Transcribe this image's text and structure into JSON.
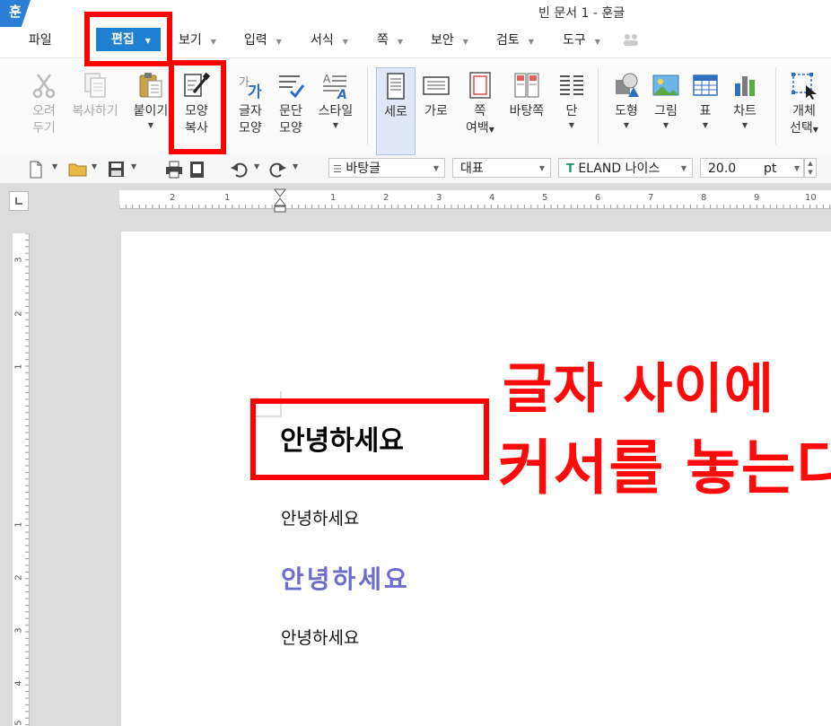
{
  "app": {
    "icon_text": "훈",
    "title": "빈 문서 1 - 훈글"
  },
  "menu": {
    "file": "파일",
    "items": [
      {
        "label": "편집",
        "active": true
      },
      {
        "label": "보기"
      },
      {
        "label": "입력"
      },
      {
        "label": "서식"
      },
      {
        "label": "쪽"
      },
      {
        "label": "보안"
      },
      {
        "label": "검토"
      },
      {
        "label": "도구"
      }
    ]
  },
  "ribbon": {
    "cut": {
      "line1": "오려",
      "line2": "두기"
    },
    "copy": {
      "label": "복사하기"
    },
    "paste": {
      "label": "붙이기"
    },
    "format_painter": {
      "line1": "모양",
      "line2": "복사"
    },
    "char_shape": {
      "line1": "글자",
      "line2": "모양"
    },
    "para_shape": {
      "line1": "문단",
      "line2": "모양"
    },
    "style": {
      "label": "스타일"
    },
    "portrait": {
      "label": "세로"
    },
    "landscape": {
      "label": "가로"
    },
    "page_margin": {
      "line1": "쪽",
      "line2": "여백"
    },
    "master_page": {
      "label": "바탕쪽"
    },
    "columns": {
      "label": "단"
    },
    "shape": {
      "label": "도형"
    },
    "picture": {
      "label": "그림"
    },
    "table": {
      "label": "표"
    },
    "chart": {
      "label": "차트"
    },
    "object_select": {
      "line1": "개체",
      "line2": "선택"
    }
  },
  "toolbar": {
    "style_select": "바탕글",
    "lang_select": "대표",
    "font_select": "ELAND 나이스",
    "font_size": "20.0",
    "font_unit": "pt"
  },
  "rulers": {
    "horizontal": [
      "2",
      "1",
      "1",
      "2",
      "3",
      "4",
      "5",
      "6",
      "7",
      "8",
      "9",
      "10"
    ],
    "vertical": [
      "3",
      "2",
      "1",
      "1",
      "2",
      "3",
      "4",
      "5"
    ]
  },
  "document": {
    "lines": [
      "안녕하세요",
      "안녕하세요",
      "안녕하세요",
      "안녕하세요"
    ]
  },
  "annotation": {
    "line1": "글자 사이에",
    "line2": "커서를 놓는다"
  },
  "colors": {
    "accent": "#1f7fd0",
    "annotation_red": "#ff0000",
    "purple_text": "#6b6ccc"
  }
}
